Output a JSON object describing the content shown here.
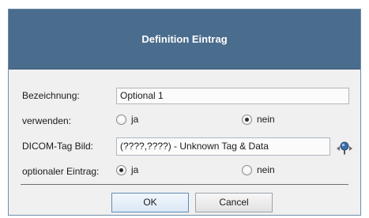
{
  "dialog": {
    "title": "Definition Eintrag"
  },
  "form": {
    "bezeichnung": {
      "label": "Bezeichnung:",
      "value": "Optional 1"
    },
    "verwenden": {
      "label": "verwenden:",
      "option_yes": "ja",
      "option_no": "nein",
      "selected": "nein"
    },
    "dicom_tag": {
      "label": "DICOM-Tag Bild:",
      "value": "(????,????) - Unknown Tag & Data",
      "picker_icon": "tag-picker-icon"
    },
    "optionaler_eintrag": {
      "label": "optionaler Eintrag:",
      "option_yes": "ja",
      "option_no": "nein",
      "selected": "ja"
    }
  },
  "buttons": {
    "ok": "OK",
    "cancel": "Cancel"
  },
  "colors": {
    "titlebar": "#4a6c8d",
    "body": "#f0f0f0"
  }
}
